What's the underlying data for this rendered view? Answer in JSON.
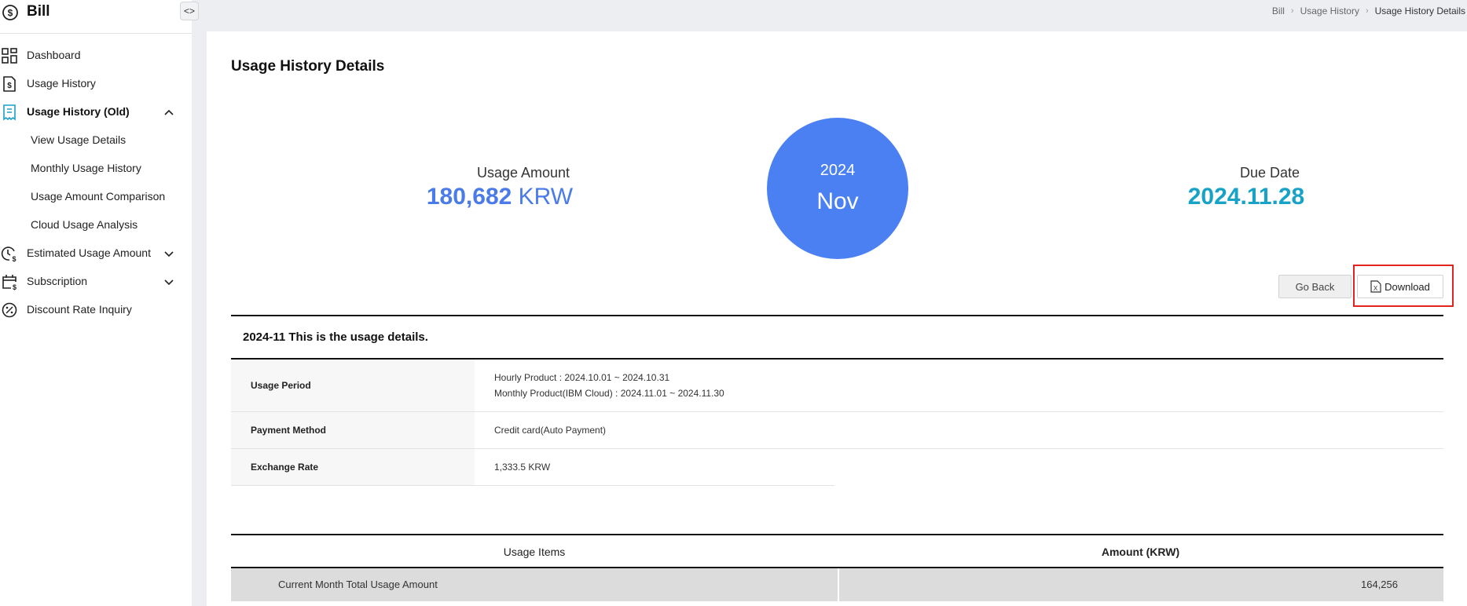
{
  "app": {
    "title": "Bill"
  },
  "breadcrumb": {
    "items": [
      "Bill",
      "Usage History",
      "Usage History Details"
    ]
  },
  "sidebar": {
    "items": [
      {
        "label": "Dashboard",
        "icon": "dashboard-grid-icon"
      },
      {
        "label": "Usage History",
        "icon": "invoice-dollar-icon"
      },
      {
        "label": "Usage History (Old)",
        "icon": "receipt-icon",
        "expanded": true,
        "children": [
          "View Usage Details",
          "Monthly Usage History",
          "Usage Amount Comparison",
          "Cloud Usage Analysis"
        ]
      },
      {
        "label": "Estimated Usage Amount",
        "icon": "clock-dollar-icon"
      },
      {
        "label": "Subscription",
        "icon": "calendar-dollar-icon"
      },
      {
        "label": "Discount Rate Inquiry",
        "icon": "percent-icon"
      }
    ]
  },
  "page": {
    "title": "Usage History Details",
    "usage_amount": {
      "label": "Usage Amount",
      "value": "180,682",
      "unit": "KRW"
    },
    "period": {
      "year": "2024",
      "month": "Nov"
    },
    "due_date": {
      "label": "Due Date",
      "value": "2024.11.28"
    },
    "buttons": {
      "back": "Go Back",
      "download": "Download"
    },
    "section_title": "2024-11 This is the usage details.",
    "info": {
      "usage_period_label": "Usage Period",
      "usage_period_line1": "Hourly Product : 2024.10.01 ~ 2024.10.31",
      "usage_period_line2": "Monthly Product(IBM Cloud) : 2024.11.01 ~ 2024.11.30",
      "payment_method_label": "Payment Method",
      "payment_method_value": "Credit card(Auto Payment)",
      "exchange_rate_label": "Exchange Rate",
      "exchange_rate_value": "1,333.5 KRW"
    },
    "items_table": {
      "col_items": "Usage Items",
      "col_amount": "Amount (KRW)",
      "total_label": "Current Month Total Usage Amount",
      "total_value": "164,256"
    }
  },
  "colors": {
    "accent": "#4b80f2",
    "due": "#16a3c7",
    "highlight": "#e02424"
  }
}
